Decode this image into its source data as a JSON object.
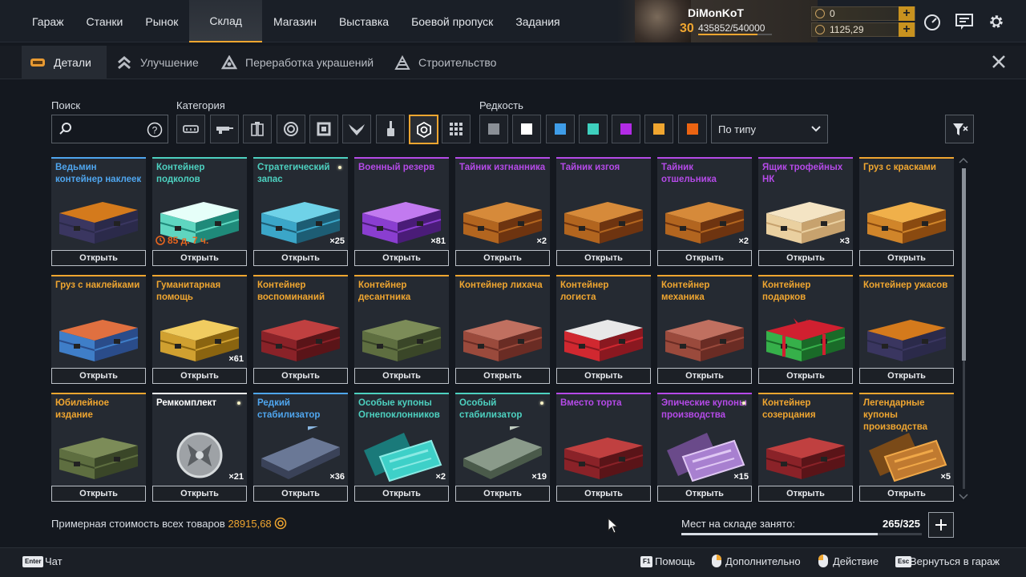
{
  "nav": {
    "tabs": [
      "Гараж",
      "Станки",
      "Рынок",
      "Склад",
      "Магазин",
      "Выставка",
      "Боевой пропуск",
      "Задания"
    ],
    "active": "Склад"
  },
  "player": {
    "name": "DiMonKoT",
    "level": "30",
    "xp": "435852/540000",
    "xp_fraction": 0.807
  },
  "currency": {
    "top": "0",
    "bottom": "1125,29"
  },
  "subtabs": {
    "items": [
      "Детали",
      "Улучшение",
      "Переработка украшений",
      "Строительство"
    ],
    "active": "Детали"
  },
  "filters": {
    "search_label": "Поиск",
    "search_placeholder": "",
    "category_label": "Категория",
    "rarity_label": "Редкость",
    "sort_value": "По типу",
    "categories": [
      "armor",
      "weapon",
      "modules",
      "wheels",
      "frames",
      "decor",
      "paint",
      "containers",
      "all"
    ],
    "active_category": "containers",
    "rarities": [
      "#8a8f96",
      "#ffffff",
      "#3f9de8",
      "#3ed0be",
      "#b22be6",
      "#f0a630",
      "#ec6412"
    ]
  },
  "items": [
    {
      "title": "Ведьмин контейнер наклеек",
      "color": "#4fa6ef",
      "count": "",
      "timer": "",
      "art": "halloween",
      "dot": false
    },
    {
      "title": "Контейнер подколов",
      "color": "#4dd1c0",
      "count": "",
      "timer": "85 д. 7 ч.",
      "art": "teal",
      "dot": false
    },
    {
      "title": "Стратегический запас",
      "color": "#4dd1c0",
      "count": "×25",
      "timer": "",
      "art": "cyan",
      "dot": true
    },
    {
      "title": "Военный резерв",
      "color": "#b54ae8",
      "count": "×81",
      "timer": "",
      "art": "purple",
      "dot": false
    },
    {
      "title": "Тайник изгнанника",
      "color": "#b54ae8",
      "count": "×2",
      "timer": "",
      "art": "copper",
      "dot": false
    },
    {
      "title": "Тайник изгоя",
      "color": "#b54ae8",
      "count": "",
      "timer": "",
      "art": "copper",
      "dot": false
    },
    {
      "title": "Тайник отшельника",
      "color": "#b54ae8",
      "count": "×2",
      "timer": "",
      "art": "copper",
      "dot": false
    },
    {
      "title": "Ящик трофейных НК",
      "color": "#b54ae8",
      "count": "×3",
      "timer": "",
      "art": "cardboard",
      "dot": false
    },
    {
      "title": "Груз с красками",
      "color": "#f0a630",
      "count": "",
      "timer": "",
      "art": "orange",
      "dot": false
    },
    {
      "title": "Груз с наклейками",
      "color": "#f0a630",
      "count": "",
      "timer": "",
      "art": "blue",
      "dot": false
    },
    {
      "title": "Гуманитарная помощь",
      "color": "#f0a630",
      "count": "×61",
      "timer": "",
      "art": "gold",
      "dot": false
    },
    {
      "title": "Контейнер воспоминаний",
      "color": "#f0a630",
      "count": "",
      "timer": "",
      "art": "red",
      "dot": false
    },
    {
      "title": "Контейнер десантника",
      "color": "#f0a630",
      "count": "",
      "timer": "",
      "art": "olive",
      "dot": false
    },
    {
      "title": "Контейнер лихача",
      "color": "#f0a630",
      "count": "",
      "timer": "",
      "art": "rust",
      "dot": false
    },
    {
      "title": "Контейнер логиста",
      "color": "#f0a630",
      "count": "",
      "timer": "",
      "art": "redwhite",
      "dot": false
    },
    {
      "title": "Контейнер механика",
      "color": "#f0a630",
      "count": "",
      "timer": "",
      "art": "rust",
      "dot": false
    },
    {
      "title": "Контейнер подарков",
      "color": "#f0a630",
      "count": "",
      "timer": "",
      "art": "gift",
      "dot": false
    },
    {
      "title": "Контейнер ужасов",
      "color": "#f0a630",
      "count": "",
      "timer": "",
      "art": "halloween",
      "dot": false
    },
    {
      "title": "Юбилейное издание",
      "color": "#f0a630",
      "count": "",
      "timer": "",
      "art": "olive",
      "dot": false
    },
    {
      "title": "Ремкомплект",
      "color": "#ffffff",
      "count": "×21",
      "timer": "",
      "art": "token",
      "dot": true
    },
    {
      "title": "Редкий стабилизатор",
      "color": "#4fa6ef",
      "count": "×36",
      "timer": "",
      "art": "stabblue",
      "dot": false
    },
    {
      "title": "Особые купоны Огнепоклонников",
      "color": "#4dd1c0",
      "count": "×2",
      "timer": "",
      "art": "coupteal",
      "dot": false
    },
    {
      "title": "Особый стабилизатор",
      "color": "#4dd1c0",
      "count": "×19",
      "timer": "",
      "art": "stabgreen",
      "dot": true
    },
    {
      "title": "Вместо торта",
      "color": "#b54ae8",
      "count": "",
      "timer": "",
      "art": "red",
      "dot": false
    },
    {
      "title": "Эпические купоны производства",
      "color": "#b54ae8",
      "count": "×15",
      "timer": "",
      "art": "couppurple",
      "dot": true
    },
    {
      "title": "Контейнер созерцания",
      "color": "#f0a630",
      "count": "",
      "timer": "",
      "art": "red",
      "dot": false
    },
    {
      "title": "Легендарные купоны производства",
      "color": "#f0a630",
      "count": "×5",
      "timer": "",
      "art": "couporange",
      "dot": false
    }
  ],
  "open_label": "Открыть",
  "total": {
    "label": "Примерная стоимость всех товаров",
    "value": "28915,68"
  },
  "storage": {
    "label": "Мест на складе занято:",
    "value": "265/325",
    "fraction": 0.815
  },
  "footer": {
    "chat_key": "Enter",
    "chat": "Чат",
    "help_key": "F1",
    "help": "Помощь",
    "more": "Дополнительно",
    "action": "Действие",
    "back_key": "Esc",
    "back": "Вернуться в гараж"
  }
}
